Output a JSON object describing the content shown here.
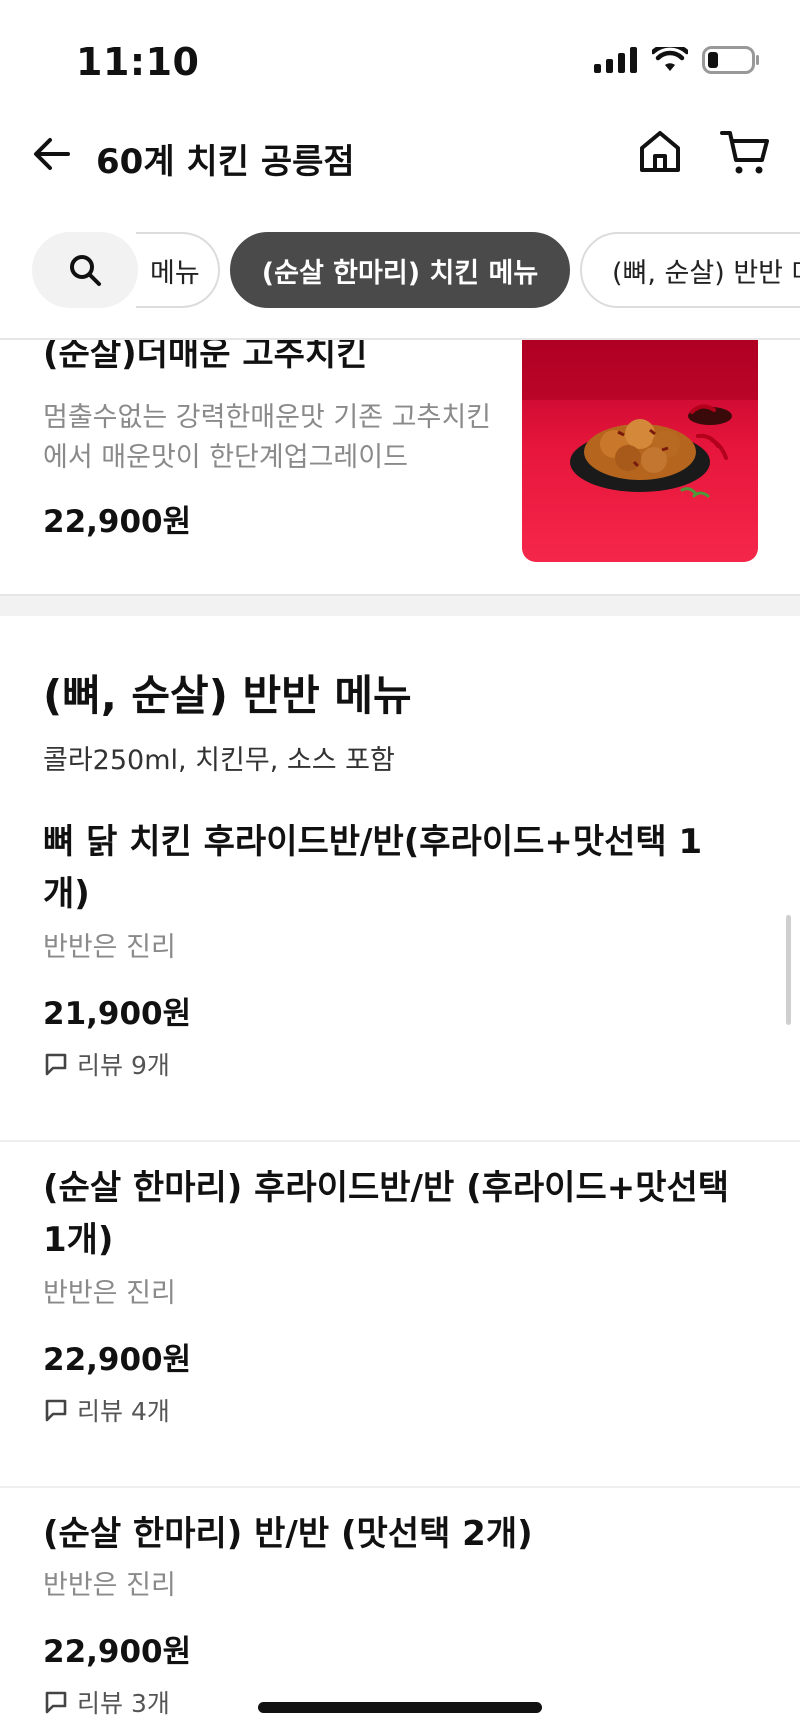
{
  "status_bar": {
    "time": "11:10",
    "icons": [
      "signal-icon",
      "wifi-icon",
      "battery-icon"
    ]
  },
  "header": {
    "title": "60계 치킨 공릉점",
    "icons": [
      "back-arrow-icon",
      "home-icon",
      "cart-icon"
    ]
  },
  "tabs": {
    "prev_label": "메뉴",
    "active_label": "(순살 한마리) 치킨 메뉴",
    "next_label": "(뼈, 순살) 반반 메뉴"
  },
  "top_item": {
    "name": "(순살)더매운 고추치킨",
    "desc_line1": "멈출수없는 강력한매운맛 기존 고추치킨",
    "desc_line2": "에서 매운맛이 한단계업그레이드",
    "price": "22,900원"
  },
  "section": {
    "title": "(뼈, 순살) 반반 메뉴",
    "subtitle": "콜라250ml, 치킨무, 소스 포함"
  },
  "items": [
    {
      "name_line1": "뼈 닭 치킨 후라이드반/반(후라이드+맛선택 1",
      "name_line2": "개)",
      "desc": "반반은 진리",
      "price": "21,900원",
      "review": "리뷰 9개"
    },
    {
      "name_line1": "(순살 한마리) 후라이드반/반 (후라이드+맛선택",
      "name_line2": "1개)",
      "desc": "반반은 진리",
      "price": "22,900원",
      "review": "리뷰 4개"
    },
    {
      "name_line1": "(순살 한마리) 반/반 (맛선택 2개)",
      "desc": "반반은 진리",
      "price": "22,900원",
      "review": "리뷰 3개"
    }
  ],
  "colors": {
    "active_tab": "#4a4a4a",
    "food_image_bg": "#e8163c",
    "price_text": "#111111",
    "desc_text": "#8a8a8a"
  }
}
